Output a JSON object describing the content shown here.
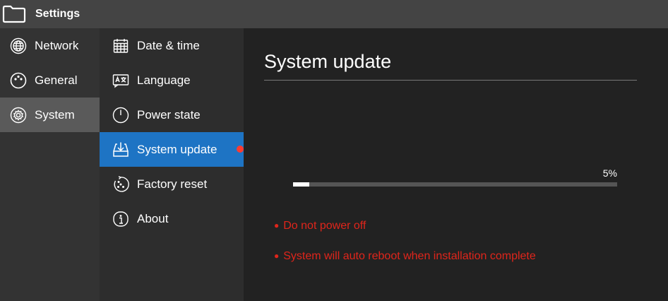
{
  "app": {
    "title": "Settings"
  },
  "primary_nav": [
    {
      "label": "Network",
      "icon": "globe-icon",
      "active": false
    },
    {
      "label": "General",
      "icon": "dots-circle-icon",
      "active": false
    },
    {
      "label": "System",
      "icon": "gear-icon",
      "active": true
    }
  ],
  "secondary_nav": [
    {
      "label": "Date & time",
      "icon": "calendar-icon",
      "active": false
    },
    {
      "label": "Language",
      "icon": "language-icon",
      "active": false
    },
    {
      "label": "Power state",
      "icon": "power-icon",
      "active": false
    },
    {
      "label": "System update",
      "icon": "download-icon",
      "active": true,
      "badge": true
    },
    {
      "label": "Factory reset",
      "icon": "factory-reset-icon",
      "active": false
    },
    {
      "label": "About",
      "icon": "info-icon",
      "active": false
    }
  ],
  "main": {
    "title": "System update",
    "progress": {
      "percent": 5,
      "label": "5%"
    },
    "warnings": [
      "Do not power off",
      "System will auto reboot when installation complete"
    ],
    "warning_bullet": "●"
  },
  "colors": {
    "accent": "#1e74c4",
    "warning": "#e0251b",
    "badge": "#ff3b30"
  }
}
